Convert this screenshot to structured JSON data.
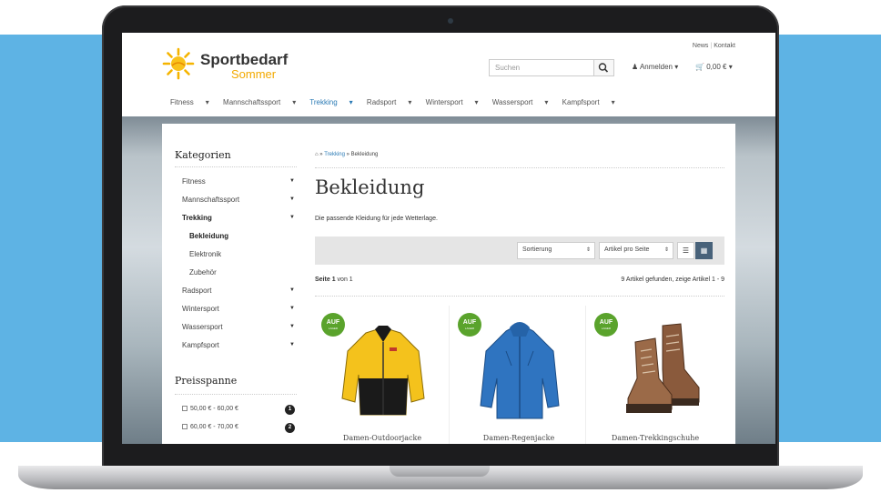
{
  "colors": {
    "accent": "#2a7ab5",
    "badge": "#5aa32c",
    "logo": "#f2a900",
    "background_band": "#5eb3e4"
  },
  "header": {
    "logo_name": "Sportbedarf",
    "logo_sub": "Sommer",
    "top_links": [
      "News",
      "Kontakt"
    ],
    "search_placeholder": "Suchen",
    "login_label": "Anmelden",
    "cart_label": "0,00 €"
  },
  "nav": [
    "Fitness",
    "Mannschaftssport",
    "Trekking",
    "Radsport",
    "Wintersport",
    "Wassersport",
    "Kampfsport"
  ],
  "sidebar": {
    "title": "Kategorien",
    "items": [
      {
        "label": "Fitness"
      },
      {
        "label": "Mannschaftssport"
      },
      {
        "label": "Trekking"
      },
      {
        "label": "Bekleidung"
      },
      {
        "label": "Elektronik"
      },
      {
        "label": "Zubehör"
      },
      {
        "label": "Radsport"
      },
      {
        "label": "Wintersport"
      },
      {
        "label": "Wassersport"
      },
      {
        "label": "Kampfsport"
      }
    ],
    "price_title": "Preisspanne",
    "price_ranges": [
      {
        "label": "50,00 € - 60,00 €",
        "count": "1"
      },
      {
        "label": "60,00 € - 70,00 €",
        "count": "2"
      }
    ]
  },
  "breadcrumb": {
    "sep": " » ",
    "items": [
      "Trekking",
      "Bekleidung"
    ]
  },
  "main": {
    "title": "Bekleidung",
    "description": "Die passende Kleidung für jede Wetterlage.",
    "sort_label": "Sortierung",
    "perpage_label": "Artikel pro Seite",
    "page_word": "Seite",
    "page_current": "1",
    "page_of": "von 1",
    "found_text": "9 Artikel gefunden, zeige Artikel 1 - 9"
  },
  "badge": {
    "line1": "AUF",
    "line2": "LAGER"
  },
  "products": [
    {
      "name": "Damen-Outdoorjacke"
    },
    {
      "name": "Damen-Regenjacke"
    },
    {
      "name": "Damen-Trekkingschuhe"
    }
  ]
}
